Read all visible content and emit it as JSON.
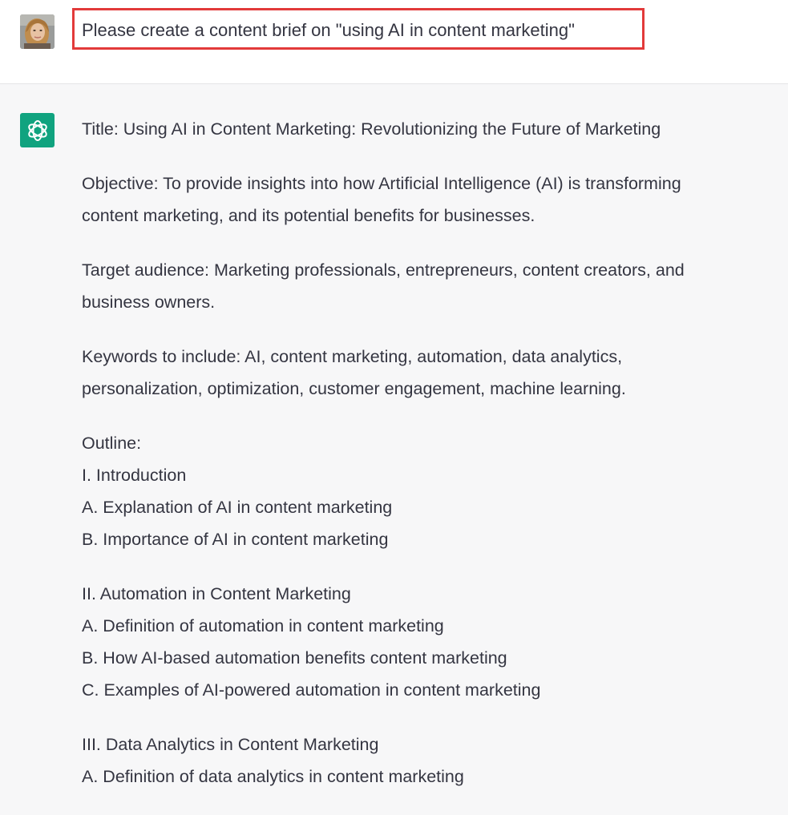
{
  "user_message": {
    "text": "Please create a content brief on \"using AI in content marketing\""
  },
  "assistant_message": {
    "title": "Title: Using AI in Content Marketing: Revolutionizing the Future of Marketing",
    "objective": [
      "Objective: To provide insights into how Artificial Intelligence (AI) is transforming",
      "content marketing, and its potential benefits for businesses."
    ],
    "target_audience": [
      "Target audience: Marketing professionals, entrepreneurs, content creators, and",
      "business owners."
    ],
    "keywords": [
      "Keywords to include: AI, content marketing, automation, data analytics,",
      "personalization, optimization, customer engagement, machine learning."
    ],
    "outline_label": "Outline:",
    "outline": [
      [
        "I. Introduction",
        "A. Explanation of AI in content marketing",
        "B. Importance of AI in content marketing"
      ],
      [
        "II. Automation in Content Marketing",
        "A. Definition of automation in content marketing",
        "B. How AI-based automation benefits content marketing",
        "C. Examples of AI-powered automation in content marketing"
      ],
      [
        "III. Data Analytics in Content Marketing",
        "A. Definition of data analytics in content marketing"
      ]
    ]
  },
  "icons": {
    "user_avatar": "user-avatar-photo",
    "assistant_avatar": "openai-logo-icon"
  },
  "colors": {
    "highlight_border": "#e23a3a",
    "assistant_avatar_bg": "#10a37f"
  }
}
